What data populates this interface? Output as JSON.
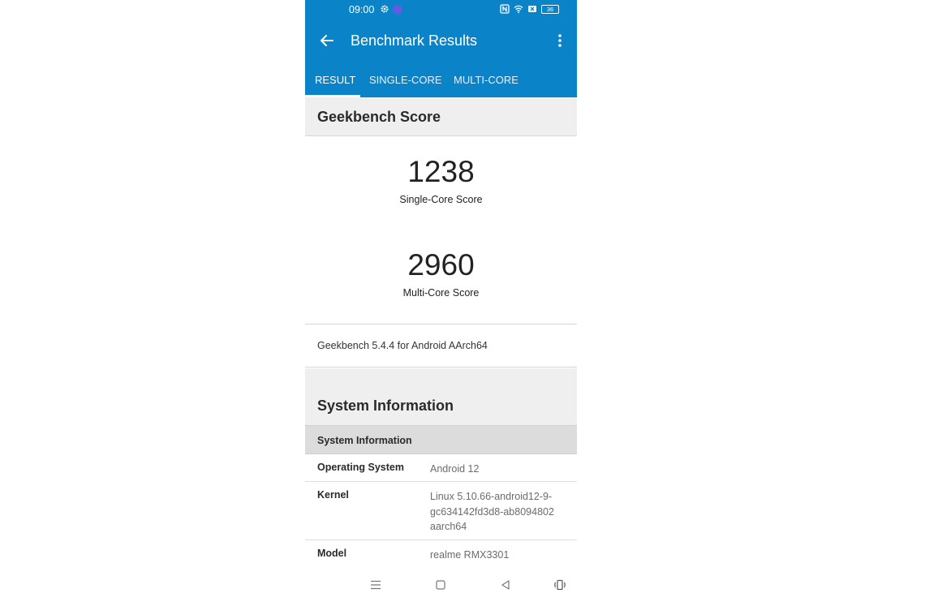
{
  "status_bar": {
    "time": "09:00",
    "battery": "36",
    "icons": [
      "gear-icon",
      "hotspot-icon",
      "nfc-icon",
      "wifi-icon",
      "notification-icon",
      "battery-icon"
    ]
  },
  "app_bar": {
    "title": "Benchmark Results",
    "back_icon": "back-arrow-icon",
    "more_icon": "more-vert-icon"
  },
  "tabs": [
    {
      "label": "RESULT",
      "selected": true
    },
    {
      "label": "SINGLE-CORE",
      "selected": false
    },
    {
      "label": "MULTI-CORE",
      "selected": false
    }
  ],
  "geekbench": {
    "heading": "Geekbench Score",
    "single_core": {
      "value": "1238",
      "label": "Single-Core Score"
    },
    "multi_core": {
      "value": "2960",
      "label": "Multi-Core Score"
    },
    "version": "Geekbench 5.4.4 for Android AArch64"
  },
  "system_information": {
    "heading": "System Information",
    "subheading": "System Information",
    "rows": [
      {
        "key": "Operating System",
        "value": "Android 12"
      },
      {
        "key": "Kernel",
        "value_lines": [
          "Linux 5.10.66-android12-9-",
          "gc634142fd3d8-ab8094802",
          "aarch64"
        ]
      },
      {
        "key": "Model",
        "value": "realme RMX3301"
      }
    ]
  },
  "nav_bar": {
    "icons": [
      "menu-icon",
      "home-icon",
      "back-icon",
      "rotate-icon"
    ]
  },
  "colors": {
    "primary": "#0a83c9",
    "section_bg": "#efefef",
    "subheader_bg": "#dcdcdc"
  }
}
